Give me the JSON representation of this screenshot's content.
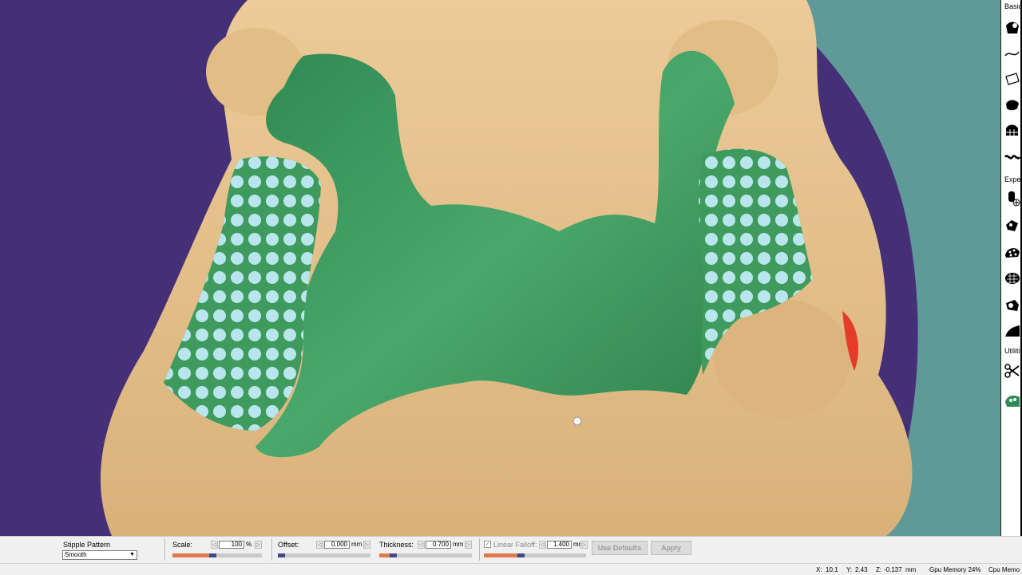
{
  "palette": {
    "sections": [
      "Basic",
      "Exper",
      "Utiliti"
    ],
    "tools": [
      {
        "icon": "drape-icon"
      },
      {
        "icon": "curve-icon"
      },
      {
        "icon": "sheet-icon"
      },
      {
        "icon": "bar-icon"
      },
      {
        "icon": "grid-shape-icon"
      },
      {
        "icon": "wave-wire-icon"
      },
      {
        "icon": "bulb-add-icon"
      },
      {
        "icon": "retention-icon"
      },
      {
        "icon": "sharp-icon"
      },
      {
        "icon": "mesh-icon"
      },
      {
        "icon": "stipple-icon"
      },
      {
        "icon": "relief-icon"
      },
      {
        "icon": "bead-icon"
      },
      {
        "icon": "scissors-icon"
      },
      {
        "icon": "part-icon"
      }
    ]
  },
  "controls": {
    "stipple_label": "Stipple Pattern",
    "stipple_value": "Smooth",
    "scale_label": "Scale:",
    "scale_value": "100",
    "scale_unit": "%",
    "scale_level": 0.45,
    "offset_label": "Offset:",
    "offset_value": "0.000",
    "offset_unit": "mm",
    "offset_level": 0.0,
    "thickness_label": "Thickness:",
    "thickness_value": "0.700",
    "thickness_unit": "mm",
    "thickness_level": 0.12,
    "falloff_label": "Linear Falloff:",
    "falloff_value": "1.400",
    "falloff_unit": "mm",
    "falloff_level": 0.35,
    "use_defaults": "Use Defaults",
    "apply": "Apply"
  },
  "status": {
    "x_label": "X:",
    "x_value": "10.1",
    "y_label": "Y:",
    "y_value": "2.43",
    "z_label": "Z:",
    "z_value": "-0.137",
    "unit": "mm",
    "gpu": "Gpu Memory 24%",
    "cpu": "Cpu Memo"
  },
  "colors": {
    "background": "#452f77",
    "model": "#e7c592",
    "framework": "#3f9a5e",
    "holes": "#b9e6ec",
    "accent": "#e07a4c",
    "thumb": "#3a4a8a"
  }
}
